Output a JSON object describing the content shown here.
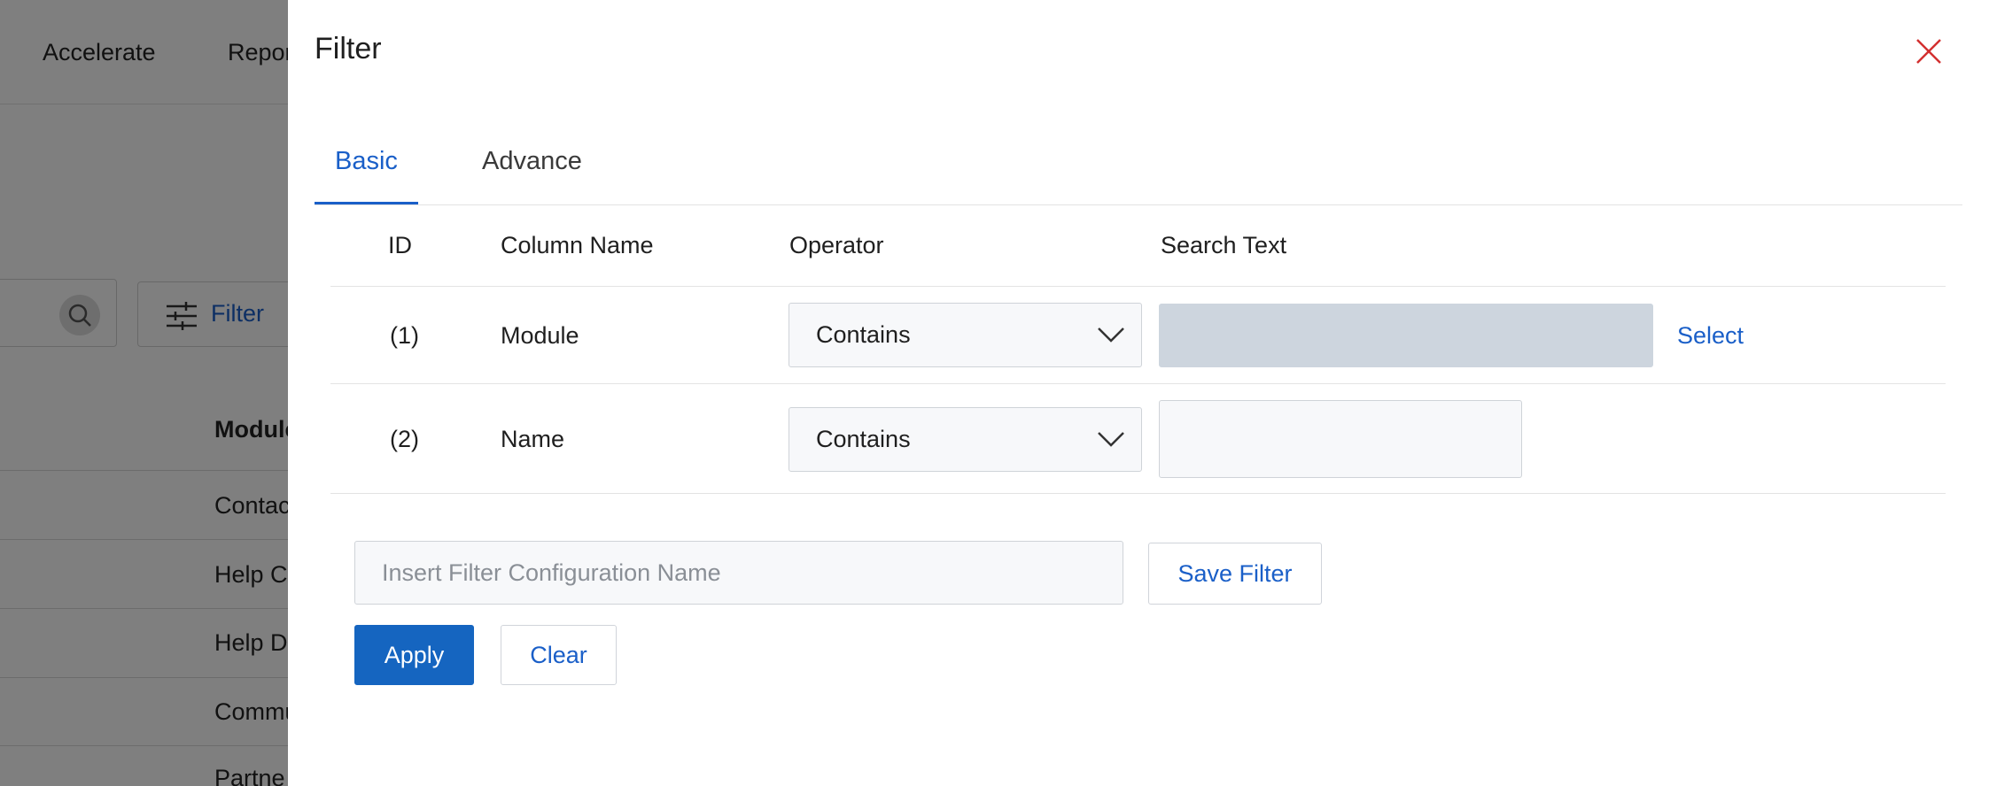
{
  "background": {
    "nav": [
      "Accelerate",
      "Repor"
    ],
    "filter_label": "Filter",
    "table_header": "Module",
    "rows": [
      "Contac",
      "Help C",
      "Help D",
      "Commu",
      "Partne"
    ]
  },
  "drawer": {
    "title": "Filter",
    "tabs": [
      {
        "label": "Basic",
        "active": true
      },
      {
        "label": "Advance",
        "active": false
      }
    ],
    "columns": {
      "id": "ID",
      "column_name": "Column Name",
      "operator": "Operator",
      "search_text": "Search Text"
    },
    "rows": [
      {
        "id": "(1)",
        "column": "Module",
        "operator": "Contains",
        "search_value": "",
        "select_label": "Select"
      },
      {
        "id": "(2)",
        "column": "Name",
        "operator": "Contains",
        "search_value": ""
      }
    ],
    "config_name": {
      "value": "",
      "placeholder": "Insert Filter Configuration Name"
    },
    "buttons": {
      "save_filter": "Save Filter",
      "apply": "Apply",
      "clear": "Clear"
    }
  },
  "colors": {
    "accent": "#1a5fc8",
    "primary_button": "#1565c0",
    "close_icon": "#d32f2f",
    "disabled_input": "#cdd5de"
  }
}
